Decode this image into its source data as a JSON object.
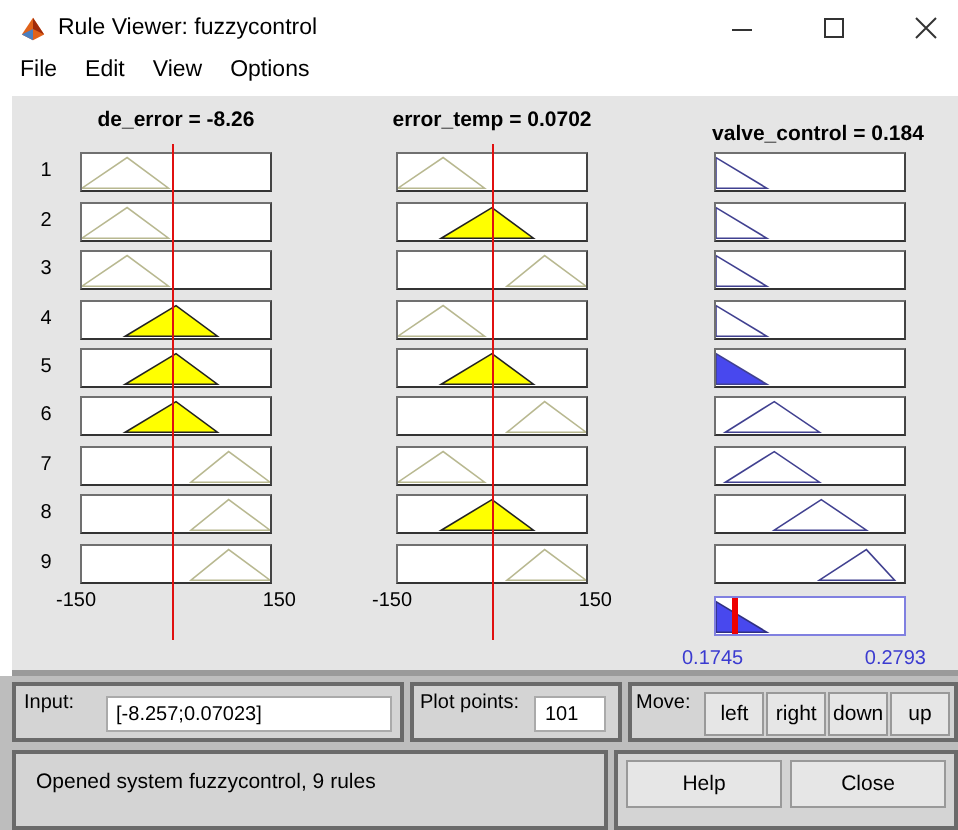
{
  "window": {
    "title": "Rule Viewer: fuzzycontrol"
  },
  "menu": [
    "File",
    "Edit",
    "View",
    "Options"
  ],
  "inputs": [
    {
      "title": "de_error = -8.26",
      "level": 0.48,
      "ticks": [
        "-150",
        "150"
      ]
    },
    {
      "title": "error_temp = 0.0702",
      "level": 0.5,
      "ticks": [
        "-150",
        "150"
      ]
    }
  ],
  "output": {
    "title": "valve_control = 0.184",
    "level": 0.09,
    "range": [
      "0.1745",
      "0.2793"
    ]
  },
  "rules": [
    {
      "number": "1",
      "antecedents": [
        {
          "kind": "low",
          "fired": false
        },
        {
          "kind": "low",
          "fired": false
        }
      ],
      "consequent": {
        "kind": "zero",
        "fired": false
      }
    },
    {
      "number": "2",
      "antecedents": [
        {
          "kind": "low",
          "fired": false
        },
        {
          "kind": "mid",
          "fired": true
        }
      ],
      "consequent": {
        "kind": "zero",
        "fired": false
      }
    },
    {
      "number": "3",
      "antecedents": [
        {
          "kind": "low",
          "fired": false
        },
        {
          "kind": "high",
          "fired": false
        }
      ],
      "consequent": {
        "kind": "zero",
        "fired": false
      }
    },
    {
      "number": "4",
      "antecedents": [
        {
          "kind": "mid",
          "fired": true
        },
        {
          "kind": "low",
          "fired": false
        }
      ],
      "consequent": {
        "kind": "zero",
        "fired": false
      }
    },
    {
      "number": "5",
      "antecedents": [
        {
          "kind": "mid",
          "fired": true
        },
        {
          "kind": "mid",
          "fired": true
        }
      ],
      "consequent": {
        "kind": "zero",
        "fired": true
      }
    },
    {
      "number": "6",
      "antecedents": [
        {
          "kind": "mid",
          "fired": true
        },
        {
          "kind": "high",
          "fired": false
        }
      ],
      "consequent": {
        "kind": "small",
        "fired": false
      }
    },
    {
      "number": "7",
      "antecedents": [
        {
          "kind": "high",
          "fired": false
        },
        {
          "kind": "low",
          "fired": false
        }
      ],
      "consequent": {
        "kind": "small",
        "fired": false
      }
    },
    {
      "number": "8",
      "antecedents": [
        {
          "kind": "high",
          "fired": false
        },
        {
          "kind": "mid",
          "fired": true
        }
      ],
      "consequent": {
        "kind": "medium",
        "fired": false
      }
    },
    {
      "number": "9",
      "antecedents": [
        {
          "kind": "high",
          "fired": false
        },
        {
          "kind": "high",
          "fired": false
        }
      ],
      "consequent": {
        "kind": "large",
        "fired": false
      }
    }
  ],
  "input_field": {
    "label": "Input:",
    "value": "[-8.257;0.07023]"
  },
  "plot_points": {
    "label": "Plot points:",
    "value": "101"
  },
  "move": {
    "label": "Move:",
    "buttons": [
      "left",
      "right",
      "down",
      "up"
    ]
  },
  "status": "Opened system fuzzycontrol, 9 rules",
  "buttons": [
    "Help",
    "Close"
  ]
}
